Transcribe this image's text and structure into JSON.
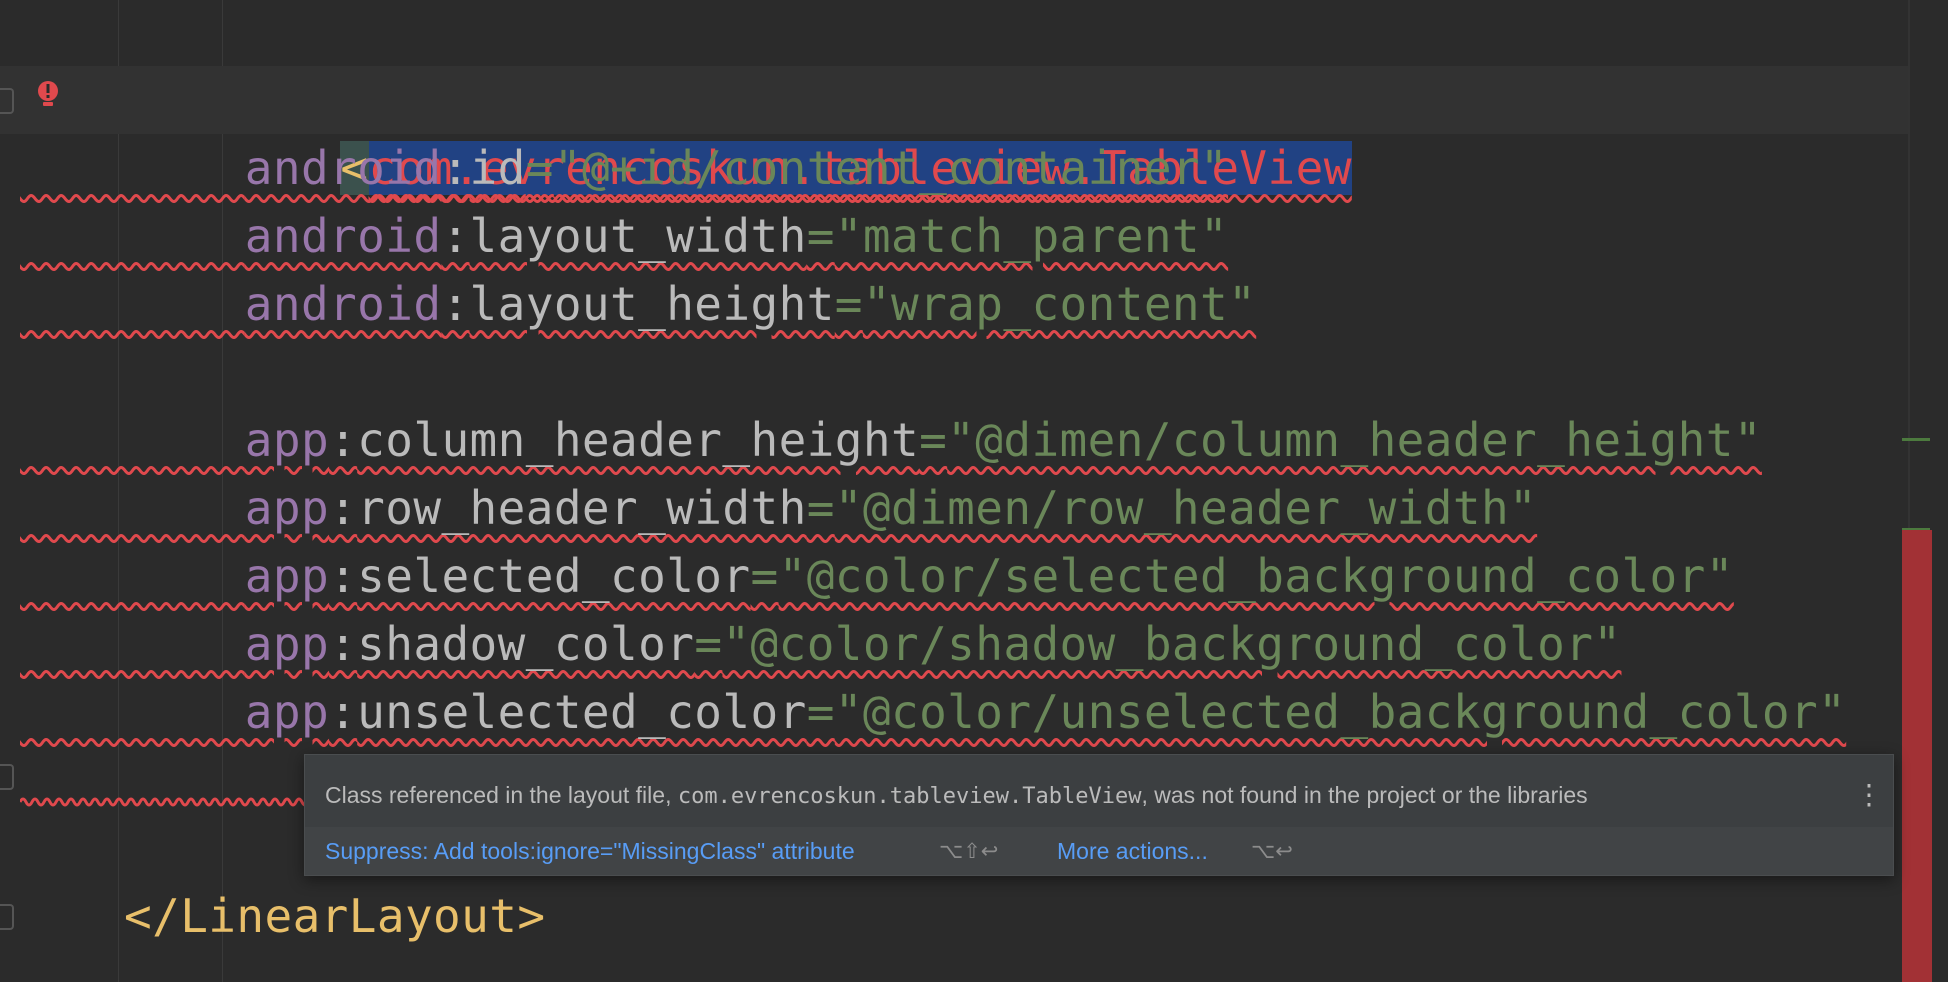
{
  "code": {
    "tag_open_bracket": "<",
    "tag_name": "com.evrencoskun.tableview.TableView",
    "attributes": [
      {
        "ns": "android",
        "colon": ":",
        "name": "id",
        "eq": "=",
        "value": "\"@+id/content_container\""
      },
      {
        "ns": "android",
        "colon": ":",
        "name": "layout_width",
        "eq": "=",
        "value": "\"match_parent\""
      },
      {
        "ns": "android",
        "colon": ":",
        "name": "layout_height",
        "eq": "=",
        "value": "\"wrap_content\""
      },
      {
        "ns": "app",
        "colon": ":",
        "name": "column_header_height",
        "eq": "=",
        "value": "\"@dimen/column_header_height\""
      },
      {
        "ns": "app",
        "colon": ":",
        "name": "row_header_width",
        "eq": "=",
        "value": "\"@dimen/row_header_width\""
      },
      {
        "ns": "app",
        "colon": ":",
        "name": "selected_color",
        "eq": "=",
        "value": "\"@color/selected_background_color\""
      },
      {
        "ns": "app",
        "colon": ":",
        "name": "shadow_color",
        "eq": "=",
        "value": "\"@color/shadow_background_color\""
      },
      {
        "ns": "app",
        "colon": ":",
        "name": "unselected_color",
        "eq": "=",
        "value": "\"@color/unselected_background_color\""
      }
    ],
    "closing_tag": "</LinearLayout>"
  },
  "popup": {
    "message_prefix": "Class referenced in the layout file, ",
    "message_class": "com.evrencoskun.tableview.TableView",
    "message_suffix": ", was not found in the project or the libraries",
    "menu_icon": "⋮",
    "action_suppress": "Suppress: Add tools:ignore=\"MissingClass\" attribute",
    "action_suppress_shortcut": "⌥⇧↩",
    "action_more": "More actions...",
    "action_more_shortcut": "⌥↩"
  },
  "icons": {
    "error_marker": "error-bulb-icon",
    "popup_menu": "vertical-ellipsis-icon"
  },
  "colors": {
    "background": "#2b2b2b",
    "error": "#e0494d",
    "selection": "#214283",
    "link": "#589df6"
  }
}
